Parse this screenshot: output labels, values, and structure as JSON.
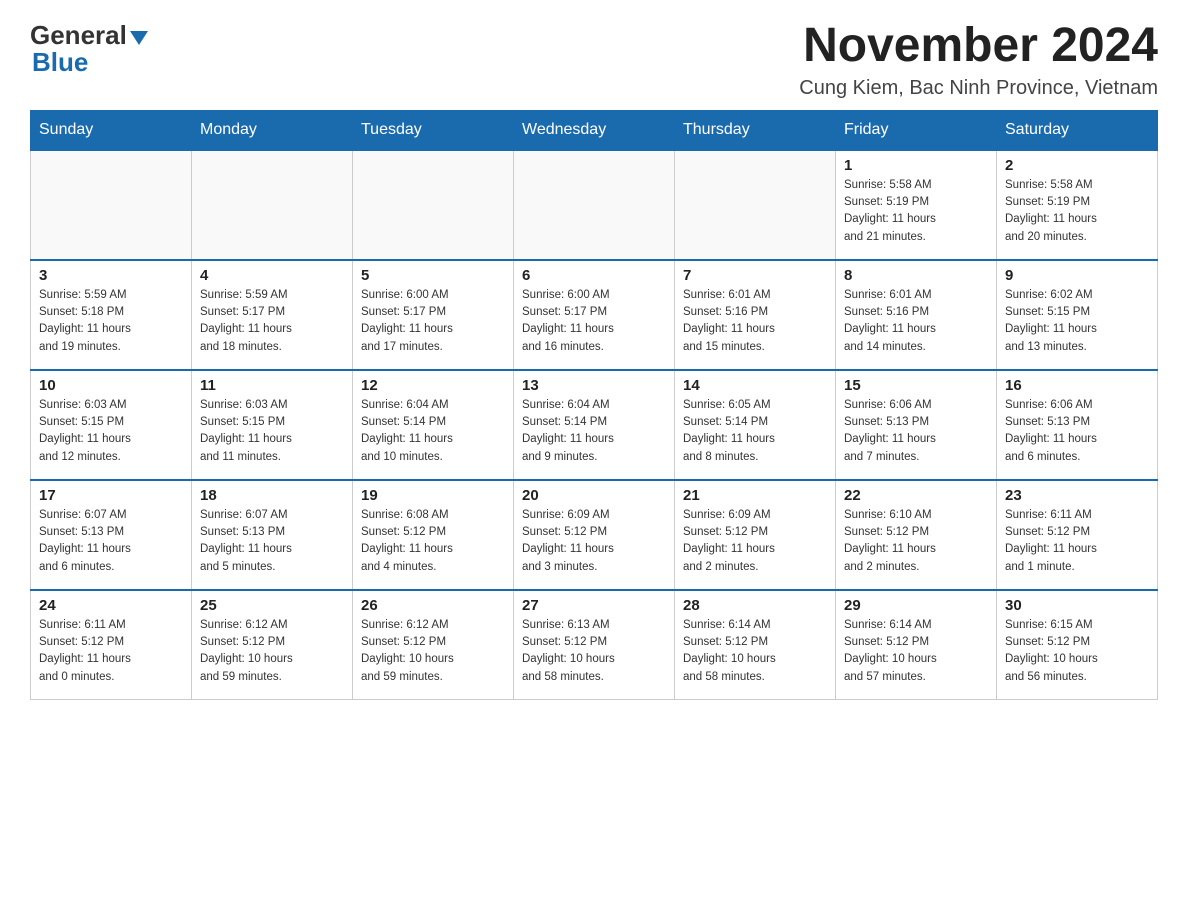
{
  "header": {
    "logo_general": "General",
    "logo_blue": "Blue",
    "title": "November 2024",
    "subtitle": "Cung Kiem, Bac Ninh Province, Vietnam"
  },
  "days_of_week": [
    "Sunday",
    "Monday",
    "Tuesday",
    "Wednesday",
    "Thursday",
    "Friday",
    "Saturday"
  ],
  "weeks": [
    [
      {
        "day": "",
        "info": ""
      },
      {
        "day": "",
        "info": ""
      },
      {
        "day": "",
        "info": ""
      },
      {
        "day": "",
        "info": ""
      },
      {
        "day": "",
        "info": ""
      },
      {
        "day": "1",
        "info": "Sunrise: 5:58 AM\nSunset: 5:19 PM\nDaylight: 11 hours\nand 21 minutes."
      },
      {
        "day": "2",
        "info": "Sunrise: 5:58 AM\nSunset: 5:19 PM\nDaylight: 11 hours\nand 20 minutes."
      }
    ],
    [
      {
        "day": "3",
        "info": "Sunrise: 5:59 AM\nSunset: 5:18 PM\nDaylight: 11 hours\nand 19 minutes."
      },
      {
        "day": "4",
        "info": "Sunrise: 5:59 AM\nSunset: 5:17 PM\nDaylight: 11 hours\nand 18 minutes."
      },
      {
        "day": "5",
        "info": "Sunrise: 6:00 AM\nSunset: 5:17 PM\nDaylight: 11 hours\nand 17 minutes."
      },
      {
        "day": "6",
        "info": "Sunrise: 6:00 AM\nSunset: 5:17 PM\nDaylight: 11 hours\nand 16 minutes."
      },
      {
        "day": "7",
        "info": "Sunrise: 6:01 AM\nSunset: 5:16 PM\nDaylight: 11 hours\nand 15 minutes."
      },
      {
        "day": "8",
        "info": "Sunrise: 6:01 AM\nSunset: 5:16 PM\nDaylight: 11 hours\nand 14 minutes."
      },
      {
        "day": "9",
        "info": "Sunrise: 6:02 AM\nSunset: 5:15 PM\nDaylight: 11 hours\nand 13 minutes."
      }
    ],
    [
      {
        "day": "10",
        "info": "Sunrise: 6:03 AM\nSunset: 5:15 PM\nDaylight: 11 hours\nand 12 minutes."
      },
      {
        "day": "11",
        "info": "Sunrise: 6:03 AM\nSunset: 5:15 PM\nDaylight: 11 hours\nand 11 minutes."
      },
      {
        "day": "12",
        "info": "Sunrise: 6:04 AM\nSunset: 5:14 PM\nDaylight: 11 hours\nand 10 minutes."
      },
      {
        "day": "13",
        "info": "Sunrise: 6:04 AM\nSunset: 5:14 PM\nDaylight: 11 hours\nand 9 minutes."
      },
      {
        "day": "14",
        "info": "Sunrise: 6:05 AM\nSunset: 5:14 PM\nDaylight: 11 hours\nand 8 minutes."
      },
      {
        "day": "15",
        "info": "Sunrise: 6:06 AM\nSunset: 5:13 PM\nDaylight: 11 hours\nand 7 minutes."
      },
      {
        "day": "16",
        "info": "Sunrise: 6:06 AM\nSunset: 5:13 PM\nDaylight: 11 hours\nand 6 minutes."
      }
    ],
    [
      {
        "day": "17",
        "info": "Sunrise: 6:07 AM\nSunset: 5:13 PM\nDaylight: 11 hours\nand 6 minutes."
      },
      {
        "day": "18",
        "info": "Sunrise: 6:07 AM\nSunset: 5:13 PM\nDaylight: 11 hours\nand 5 minutes."
      },
      {
        "day": "19",
        "info": "Sunrise: 6:08 AM\nSunset: 5:12 PM\nDaylight: 11 hours\nand 4 minutes."
      },
      {
        "day": "20",
        "info": "Sunrise: 6:09 AM\nSunset: 5:12 PM\nDaylight: 11 hours\nand 3 minutes."
      },
      {
        "day": "21",
        "info": "Sunrise: 6:09 AM\nSunset: 5:12 PM\nDaylight: 11 hours\nand 2 minutes."
      },
      {
        "day": "22",
        "info": "Sunrise: 6:10 AM\nSunset: 5:12 PM\nDaylight: 11 hours\nand 2 minutes."
      },
      {
        "day": "23",
        "info": "Sunrise: 6:11 AM\nSunset: 5:12 PM\nDaylight: 11 hours\nand 1 minute."
      }
    ],
    [
      {
        "day": "24",
        "info": "Sunrise: 6:11 AM\nSunset: 5:12 PM\nDaylight: 11 hours\nand 0 minutes."
      },
      {
        "day": "25",
        "info": "Sunrise: 6:12 AM\nSunset: 5:12 PM\nDaylight: 10 hours\nand 59 minutes."
      },
      {
        "day": "26",
        "info": "Sunrise: 6:12 AM\nSunset: 5:12 PM\nDaylight: 10 hours\nand 59 minutes."
      },
      {
        "day": "27",
        "info": "Sunrise: 6:13 AM\nSunset: 5:12 PM\nDaylight: 10 hours\nand 58 minutes."
      },
      {
        "day": "28",
        "info": "Sunrise: 6:14 AM\nSunset: 5:12 PM\nDaylight: 10 hours\nand 58 minutes."
      },
      {
        "day": "29",
        "info": "Sunrise: 6:14 AM\nSunset: 5:12 PM\nDaylight: 10 hours\nand 57 minutes."
      },
      {
        "day": "30",
        "info": "Sunrise: 6:15 AM\nSunset: 5:12 PM\nDaylight: 10 hours\nand 56 minutes."
      }
    ]
  ]
}
